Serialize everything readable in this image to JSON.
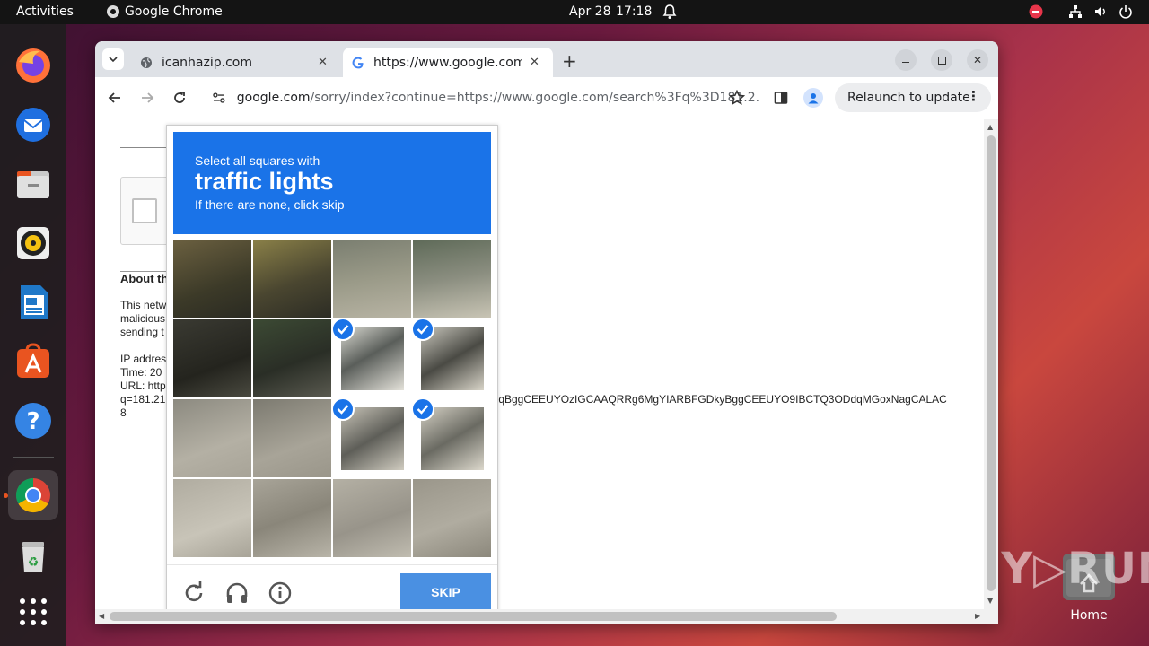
{
  "topbar": {
    "activities": "Activities",
    "app_name": "Google Chrome",
    "date": "Apr 28",
    "time": "17:18"
  },
  "dock": {
    "items": [
      "firefox-icon",
      "thunderbird-icon",
      "files-icon",
      "rhythmbox-icon",
      "writer-icon",
      "app-center-icon",
      "help-icon",
      "chrome-icon",
      "trash-icon",
      "show-apps-icon"
    ]
  },
  "desktop": {
    "home_label": "Home",
    "watermark": "ANY▷RUN"
  },
  "browser": {
    "tabs": [
      {
        "title": "icanhazip.com"
      },
      {
        "title": "https://www.google.com"
      }
    ],
    "url_domain": "google.com",
    "url_path": "/sorry/index?continue=https://www.google.com/search%3Fq%3D181.2...",
    "relaunch_label": "Relaunch to update"
  },
  "page": {
    "about_heading": "About th",
    "para_lines": [
      "This netw",
      "malicious",
      "sending t"
    ],
    "ip_line": "IP addres",
    "time_line": "Time: 20",
    "url_line": "URL: http",
    "q_line": "q=181.21",
    "q_tail": "IqBggCEEUYOzIGCAAQRRg6MgYIARBFGDkyBggCEEUYO9IBCTQ3ODdqMGoxNagCALAC",
    "last_line": "8"
  },
  "captcha": {
    "instruction_top": "Select all squares with",
    "target": "traffic lights",
    "instruction_bottom": "If there are none, click skip",
    "skip_label": "SKIP",
    "selected_cells": [
      6,
      7,
      10,
      11
    ]
  }
}
